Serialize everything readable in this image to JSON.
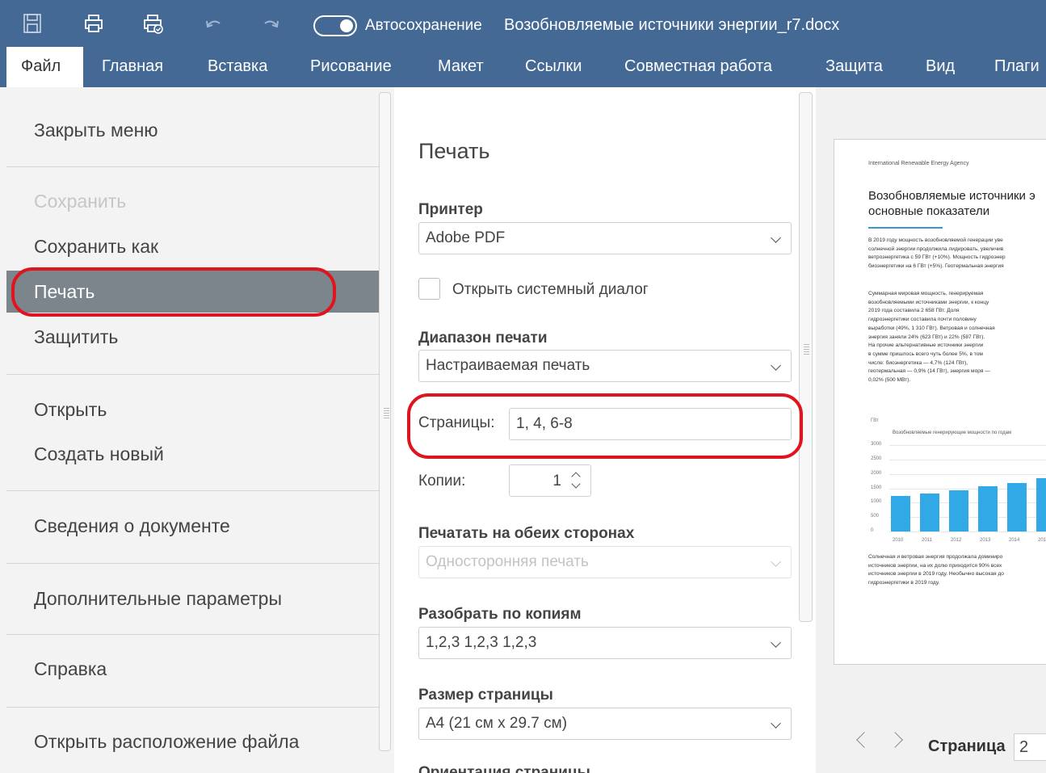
{
  "titlebar": {
    "autosave_label": "Автосохранение",
    "autosave_on": true,
    "document_name": "Возобновляемые источники энергии_r7.docx",
    "quick_access": [
      "save-icon",
      "print-icon",
      "quick-print-icon",
      "undo-icon",
      "redo-icon"
    ]
  },
  "tabs": [
    "Файл",
    "Главная",
    "Вставка",
    "Рисование",
    "Макет",
    "Ссылки",
    "Совместная работа",
    "Защита",
    "Вид",
    "Плаги"
  ],
  "menu": {
    "close": "Закрыть меню",
    "save": "Сохранить",
    "save_as": "Сохранить как",
    "print": "Печать",
    "protect": "Защитить",
    "open": "Открыть",
    "create_new": "Создать новый",
    "doc_info": "Сведения о документе",
    "advanced": "Дополнительные параметры",
    "help": "Справка",
    "open_location": "Открыть расположение файла"
  },
  "print": {
    "title": "Печать",
    "printer_label": "Принтер",
    "printer_value": "Adobe PDF",
    "system_dialog_label": "Открыть системный диалог",
    "range_label": "Диапазон печати",
    "range_value": "Настраиваемая печать",
    "pages_label": "Страницы:",
    "pages_value": "1, 4, 6-8",
    "copies_label": "Копии:",
    "copies_value": "1",
    "duplex_label": "Печатать на обеих сторонах",
    "duplex_value": "Односторонняя печать",
    "collate_label": "Разобрать по копиям",
    "collate_value": "1,2,3  1,2,3  1,2,3",
    "size_label": "Размер страницы",
    "size_value": "A4 (21 см x 29.7 см)",
    "orientation_label": "Ориентация страницы"
  },
  "preview": {
    "agency": "International Renewable Energy Agency",
    "title_line1": "Возобновляемые источники э",
    "title_line2": "основные показатели",
    "para1": [
      "В 2019 году мощность возобновляемой генерации уве",
      "солнечной энергии продолжила лидировать, увеличив",
      "ветроэнергетика с 59 ГВт (+10%). Мощность гидроэнер",
      "биоэнергетики на 6 ГВт (+5%). Геотермальная энергия"
    ],
    "para2": [
      "Суммарная мировая мощность, генерируемая",
      "возобновляемыми источниками энергии, к концу",
      "2019 года составила 2 658 ГВт. Доля",
      "гидроэнергетики составила почти половину",
      "выработки (49%, 1 310 ГВт). Ветровая и солнечная",
      "энергия заняли 24% (623 ГВт) и 22% (587 ГВт).",
      "На прочие альтернативные источники энергии",
      "в сумме пришлось всего чуть более 5%, в том",
      "числе: биоэнергетика — 4,7% (124 ГВт),",
      "геотермальная — 0,9% (14 ГВт), энергия моря —",
      "0,02% (500 МВт)."
    ],
    "para3": [
      "Солнечная и ветровая энергия продолжала доминиро",
      "источников энергии, на их долю приходится 90% всех",
      "источников энергии в 2019 году. Необычно высокая до",
      "гидроэнергетики в 2019 году."
    ],
    "page_label": "Страница",
    "page_number": "2"
  },
  "chart_data": {
    "type": "bar",
    "title": "Возобновляемые генерирующие мощности по годам",
    "ylabel": "ГВт",
    "categories": [
      "2010",
      "2011",
      "2012",
      "2013",
      "2014",
      "2015"
    ],
    "values": [
      1230,
      1330,
      1440,
      1560,
      1690,
      1850
    ],
    "yticks": [
      "3000",
      "2500",
      "2000",
      "1500",
      "1000",
      "500",
      "0"
    ],
    "ylim": [
      0,
      3000
    ],
    "bar_color": "#30a9e6"
  },
  "colors": {
    "header": "#446995",
    "menu_active": "#7d858c",
    "highlight": "#e0141e"
  }
}
